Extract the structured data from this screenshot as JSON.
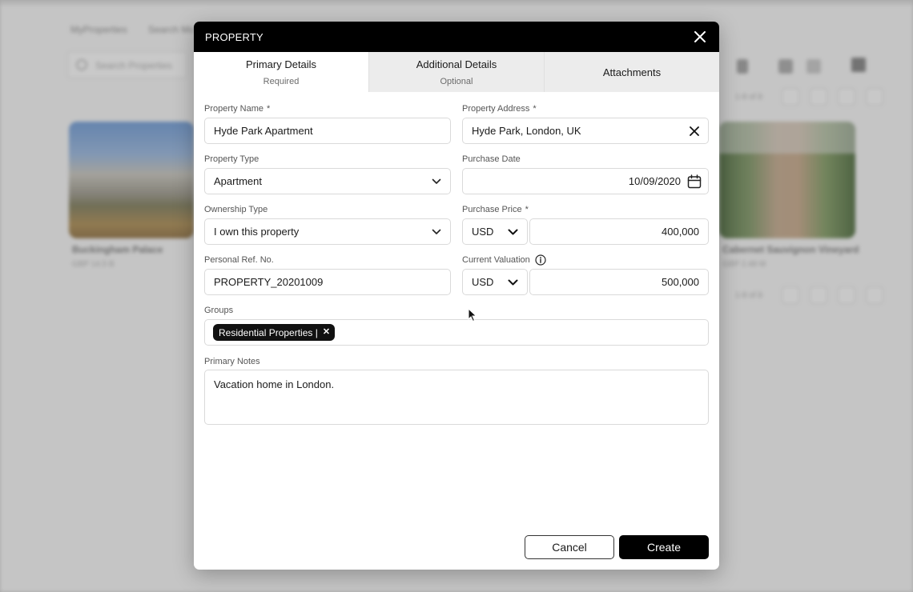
{
  "modal": {
    "title": "PROPERTY",
    "close_icon": "close-icon"
  },
  "tabs": [
    {
      "label": "Primary Details",
      "sub": "Required",
      "active": true
    },
    {
      "label": "Additional Details",
      "sub": "Optional",
      "active": false
    },
    {
      "label": "Attachments",
      "sub": "",
      "active": false
    }
  ],
  "form": {
    "property_name": {
      "label": "Property Name",
      "required_mark": "*",
      "value": "Hyde Park Apartment"
    },
    "property_address": {
      "label": "Property Address",
      "required_mark": "*",
      "value": "Hyde Park, London, UK",
      "icon": "clear-icon"
    },
    "property_type": {
      "label": "Property Type",
      "value": "Apartment",
      "icon": "chevron-down-icon"
    },
    "purchase_date": {
      "label": "Purchase Date",
      "value": "10/09/2020",
      "icon": "calendar-icon"
    },
    "ownership_type": {
      "label": "Ownership Type",
      "value": "I own this property",
      "icon": "chevron-down-icon"
    },
    "purchase_price": {
      "label": "Purchase Price",
      "required_mark": "*",
      "currency": "USD",
      "value": "400,000"
    },
    "personal_ref": {
      "label": "Personal Ref. No.",
      "value": "PROPERTY_20201009"
    },
    "current_valuation": {
      "label": "Current Valuation",
      "currency": "USD",
      "value": "500,000",
      "icon": "info-icon"
    },
    "groups": {
      "label": "Groups",
      "chips": [
        "Residential Properties |"
      ]
    },
    "primary_notes": {
      "label": "Primary Notes",
      "value": "Vacation home in London."
    }
  },
  "buttons": {
    "cancel": "Cancel",
    "create": "Create"
  },
  "background": {
    "nav": [
      "MyProperties",
      "Search Mo"
    ],
    "search_placeholder": "Search Properties",
    "cards": [
      {
        "title": "Buckingham Palace",
        "sub": "GBP 14.5 B"
      },
      {
        "title": "Cabernet Sauvignon Vineyard",
        "sub": "GBP 2.48 M"
      }
    ],
    "pages_text": "1-8 of 8"
  }
}
